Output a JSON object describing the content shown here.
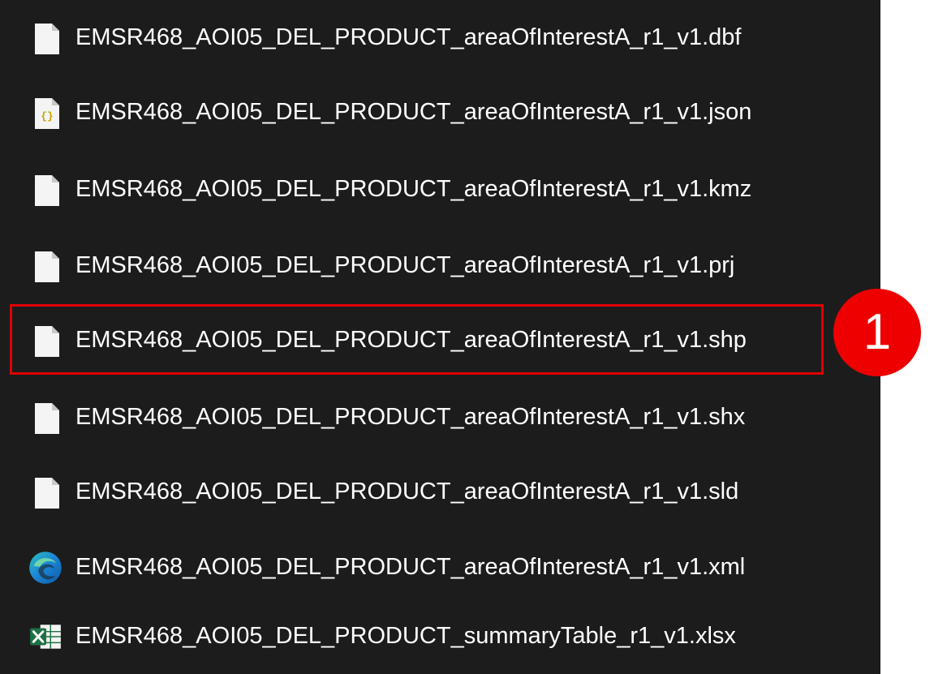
{
  "files": [
    {
      "name": "EMSR468_AOI05_DEL_PRODUCT_areaOfInterestA_r1_v1.dbf",
      "icon": "blank-file-icon"
    },
    {
      "name": "EMSR468_AOI05_DEL_PRODUCT_areaOfInterestA_r1_v1.json",
      "icon": "json-file-icon"
    },
    {
      "name": "EMSR468_AOI05_DEL_PRODUCT_areaOfInterestA_r1_v1.kmz",
      "icon": "blank-file-icon"
    },
    {
      "name": "EMSR468_AOI05_DEL_PRODUCT_areaOfInterestA_r1_v1.prj",
      "icon": "blank-file-icon"
    },
    {
      "name": "EMSR468_AOI05_DEL_PRODUCT_areaOfInterestA_r1_v1.shp",
      "icon": "blank-file-icon",
      "highlighted": true
    },
    {
      "name": "EMSR468_AOI05_DEL_PRODUCT_areaOfInterestA_r1_v1.shx",
      "icon": "blank-file-icon"
    },
    {
      "name": "EMSR468_AOI05_DEL_PRODUCT_areaOfInterestA_r1_v1.sld",
      "icon": "blank-file-icon"
    },
    {
      "name": "EMSR468_AOI05_DEL_PRODUCT_areaOfInterestA_r1_v1.xml",
      "icon": "edge-browser-icon"
    },
    {
      "name": "EMSR468_AOI05_DEL_PRODUCT_summaryTable_r1_v1.xlsx",
      "icon": "excel-file-icon"
    }
  ],
  "annotation": {
    "step_number": "1",
    "color": "#e00000"
  },
  "colors": {
    "background": "#1c1c1c",
    "text": "#ffffff"
  }
}
